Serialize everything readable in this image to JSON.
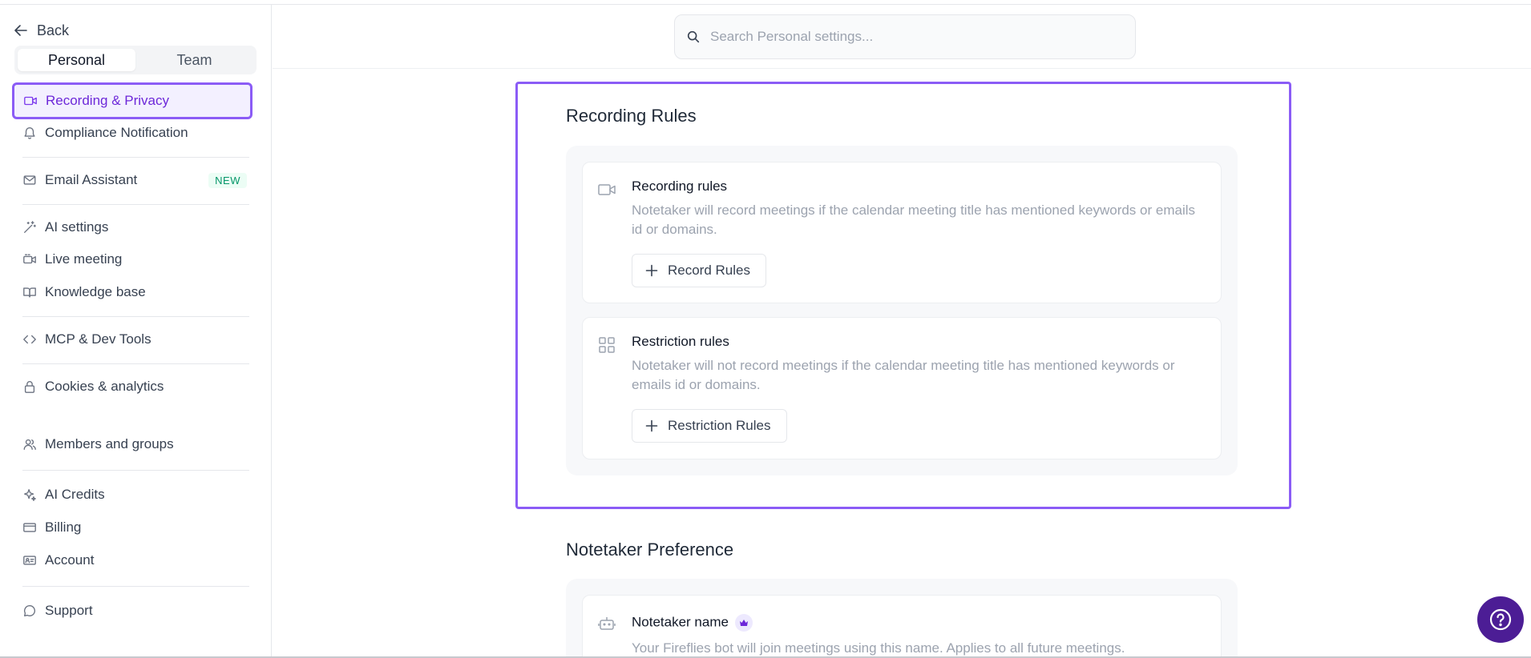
{
  "sidebar": {
    "back_label": "Back",
    "toggle": {
      "personal": "Personal",
      "team": "Team"
    },
    "items": {
      "recording_privacy": "Recording & Privacy",
      "compliance": "Compliance Notification",
      "email_assistant": "Email Assistant",
      "email_badge": "NEW",
      "ai_settings": "AI settings",
      "live_meeting": "Live meeting",
      "knowledge_base": "Knowledge base",
      "mcp": "MCP & Dev Tools",
      "cookies": "Cookies & analytics",
      "members": "Members and groups",
      "ai_credits": "AI Credits",
      "billing": "Billing",
      "account": "Account",
      "support": "Support"
    }
  },
  "search": {
    "placeholder": "Search Personal settings..."
  },
  "recording_rules": {
    "title": "Recording Rules",
    "record": {
      "title": "Recording rules",
      "description": "Notetaker will record meetings if the calendar meeting title has mentioned keywords or emails id or domains.",
      "button": "Record Rules"
    },
    "restriction": {
      "title": "Restriction rules",
      "description": "Notetaker will not record meetings if the calendar meeting title has mentioned keywords or emails id or domains.",
      "button": "Restriction Rules"
    }
  },
  "notetaker": {
    "title": "Notetaker Preference",
    "name_title": "Notetaker name",
    "name_description": "Your Fireflies bot will join meetings using this name. Applies to all future meetings."
  },
  "colors": {
    "accent": "#8b5cf6",
    "help_button": "#4c1d95"
  }
}
